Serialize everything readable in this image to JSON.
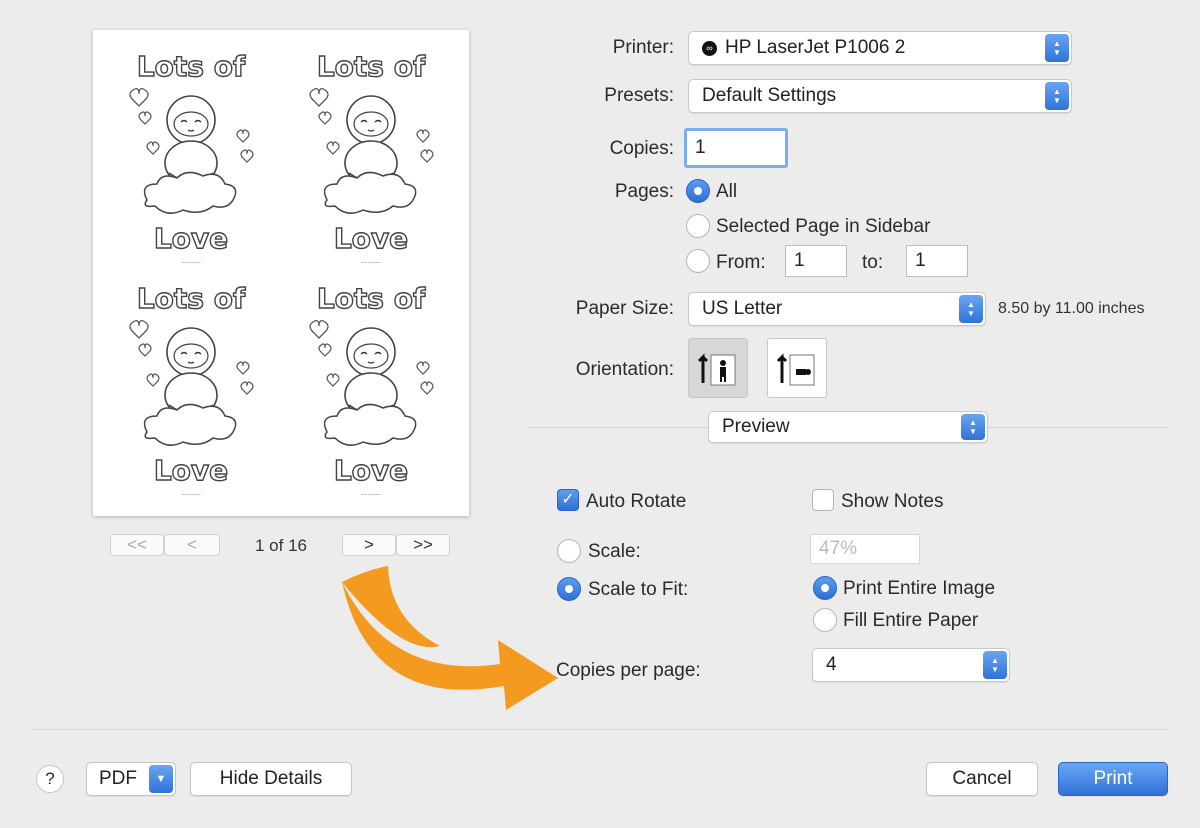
{
  "preview": {
    "card_title_top": "Lots of",
    "card_title_bottom": "Love",
    "page_indicator": "1 of 16",
    "nav": {
      "first": "<<",
      "prev": "<",
      "next": ">",
      "last": ">>"
    }
  },
  "printer": {
    "label": "Printer:",
    "value": "HP LaserJet P1006 2"
  },
  "presets": {
    "label": "Presets:",
    "value": "Default Settings"
  },
  "copies": {
    "label": "Copies:",
    "value": "1"
  },
  "pages": {
    "label": "Pages:",
    "all": "All",
    "selected": "Selected Page in Sidebar",
    "from_label": "From:",
    "from_value": "1",
    "to_label": "to:",
    "to_value": "1"
  },
  "paper_size": {
    "label": "Paper Size:",
    "value": "US Letter",
    "dimensions": "8.50 by 11.00 inches"
  },
  "orientation": {
    "label": "Orientation:"
  },
  "section_popup": {
    "value": "Preview"
  },
  "options": {
    "auto_rotate": "Auto Rotate",
    "show_notes": "Show Notes",
    "scale": "Scale:",
    "scale_value": "47%",
    "scale_to_fit": "Scale to Fit:",
    "print_entire_image": "Print Entire Image",
    "fill_entire_paper": "Fill Entire Paper",
    "copies_per_page_label": "Copies per page:",
    "copies_per_page_value": "4"
  },
  "footer": {
    "help": "?",
    "pdf": "PDF",
    "hide_details": "Hide Details",
    "cancel": "Cancel",
    "print": "Print"
  },
  "colors": {
    "accent": "#2f73d9",
    "arrow": "#f39a1f"
  }
}
